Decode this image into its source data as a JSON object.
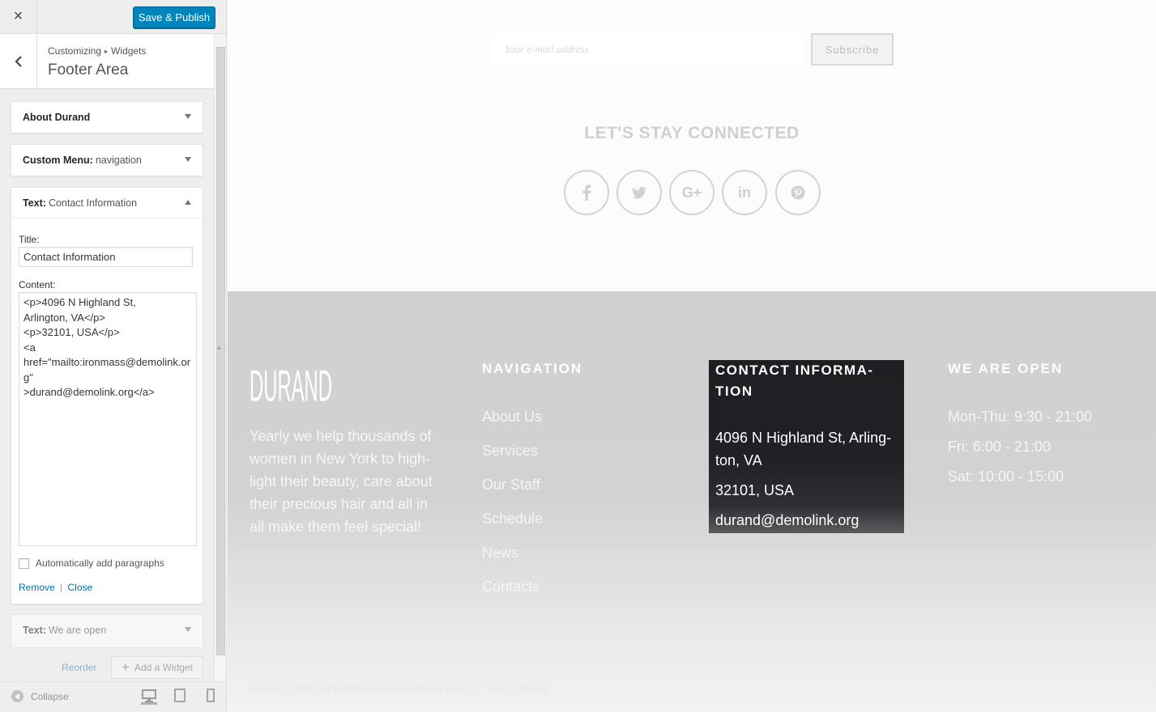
{
  "customizer": {
    "close_icon": "×",
    "save_label": "Save & Publish",
    "breadcrumb": [
      "Customizing",
      "Widgets"
    ],
    "panel_title": "Footer Area",
    "widgets": [
      {
        "name": "About Durand",
        "sub": "",
        "expanded": false
      },
      {
        "name": "Custom Menu:",
        "sub": "navigation",
        "expanded": false
      },
      {
        "name": "Text:",
        "sub": "Contact Information",
        "expanded": true
      },
      {
        "name": "Text:",
        "sub": "We are open",
        "expanded": false
      }
    ],
    "form": {
      "title_label": "Title:",
      "title_value": "Contact Information",
      "content_label": "Content:",
      "content_value": "<p>4096 N Highland St,\nArlington, VA</p>\n<p>32101, USA</p>\n<a\nhref=\"mailto:ironmass@demolink.org\"\n>durand@demolink.org</a>",
      "auto_paragraphs_label": "Automatically add paragraphs",
      "remove_label": "Remove",
      "separator": "|",
      "close_label": "Close"
    },
    "reorder_label": "Reorder",
    "add_widget_label": "Add a Widget",
    "collapse_label": "Collapse"
  },
  "preview": {
    "email_placeholder": "Your e-mail address",
    "subscribe_label": "Subscribe",
    "connected_heading": "LET'S STAY CONNECTED",
    "social_icons": [
      "facebook-icon",
      "twitter-icon",
      "google-plus-icon",
      "linkedin-icon",
      "pinterest-icon"
    ],
    "logo_text": "DURAND",
    "about_text": "Yearly we help thousands of women in New York to high-light their beauty, care about their precious hair and all in all make them feel special!",
    "navigation_title": "NAVIGATION",
    "navigation_items": [
      "About Us",
      "Services",
      "Our Staff",
      "Schedule",
      "News",
      "Contacts"
    ],
    "contact_title": "CONTACT INFORMA-TION",
    "contact_lines": [
      "4096 N Highland St, Arling-ton, VA",
      "32101, USA",
      "durand@demolink.org"
    ],
    "hours_title": "WE ARE OPEN",
    "hours_items": [
      "Mon-Thu: 9:30 - 21:00",
      "Fri: 6:00 - 21:00",
      "Sat: 10:00 - 15:00"
    ],
    "copyright_text": "Durand © 2016. All Rights Reserved. Privacy Policy. | Terms | Privacy"
  },
  "colors": {
    "primary_button": "#0085ba",
    "link": "#0073aa",
    "footer_bg": "#d0d0d0",
    "contact_box_bg": "#1d1f22"
  }
}
